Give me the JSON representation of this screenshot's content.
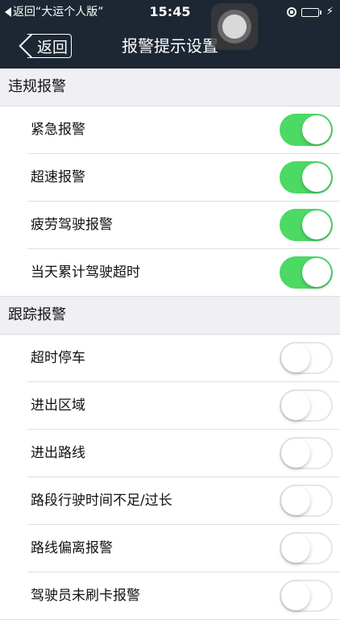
{
  "status_bar": {
    "back_app": "返回“大运个人版”",
    "time": "15:45",
    "icons": [
      "rotation-lock-icon",
      "battery-icon",
      "charging-icon"
    ]
  },
  "nav": {
    "back_label": "返回",
    "title": "报警提示设置"
  },
  "sections": [
    {
      "title": "违规报警",
      "rows": [
        {
          "label": "紧急报警",
          "on": true
        },
        {
          "label": "超速报警",
          "on": true
        },
        {
          "label": "疲劳驾驶报警",
          "on": true
        },
        {
          "label": "当天累计驾驶超时",
          "on": true
        }
      ]
    },
    {
      "title": "跟踪报警",
      "rows": [
        {
          "label": "超时停车",
          "on": false
        },
        {
          "label": "进出区域",
          "on": false
        },
        {
          "label": "进出路线",
          "on": false
        },
        {
          "label": "路段行驶时间不足/过长",
          "on": false
        },
        {
          "label": "路线偏离报警",
          "on": false
        },
        {
          "label": "驾驶员未刷卡报警",
          "on": false
        }
      ]
    }
  ],
  "colors": {
    "nav_background": "#1d2733",
    "toggle_on": "#4cd964",
    "toggle_off_border": "#e5e5ea",
    "page_background": "#efeff4"
  }
}
